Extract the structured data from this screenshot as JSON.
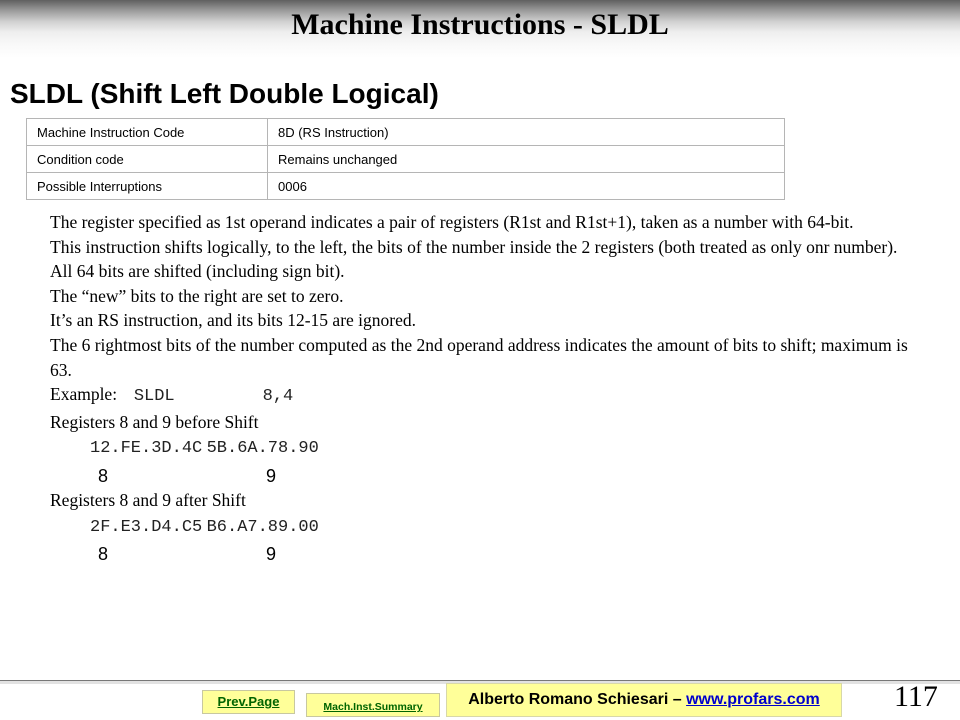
{
  "title": "Machine Instructions - SLDL",
  "subtitle": "SLDL (Shift Left Double Logical)",
  "info_table": [
    {
      "label": "Machine Instruction Code",
      "value": "8D (RS Instruction)"
    },
    {
      "label": "Condition code",
      "value": "Remains unchanged"
    },
    {
      "label": "Possible Interruptions",
      "value": "0006"
    }
  ],
  "paragraphs": [
    "The register specified as 1st operand indicates a pair of registers (R1st and R1st+1), taken as a number with 64-bit.",
    "This instruction shifts logically, to the left, the bits of the number inside the 2 registers (both treated as only onr number).",
    "All 64 bits are shifted (including sign bit).",
    "The “new” bits to the right are set to zero.",
    "It’s an RS instruction, and its bits 12-15 are ignored.",
    "The 6 rightmost bits of the number computed as the 2nd operand address indicates the amount of bits to shift; maximum is 63."
  ],
  "example": {
    "label": "Example:",
    "mnemonic": "SLDL",
    "operands": "8,4"
  },
  "before": {
    "heading": "Registers 8 and 9 before Shift",
    "reg1": "12.FE.3D.4C",
    "reg2": "5B.6A.78.90",
    "label1": "8",
    "label2": "9"
  },
  "after": {
    "heading": "Registers 8 and 9 after Shift",
    "reg1": "2F.E3.D4.C5",
    "reg2": "B6.A7.89.00",
    "label1": "8",
    "label2": "9"
  },
  "footer": {
    "prev_page": "Prev.Page",
    "summary": "Mach.Inst.Summary",
    "author": "Alberto Romano Schiesari – ",
    "website": "www.profars.com",
    "page_number": "117"
  },
  "colors": {
    "button_bg": "#ffff99",
    "button_text": "#006400",
    "link": "#0000cc"
  }
}
